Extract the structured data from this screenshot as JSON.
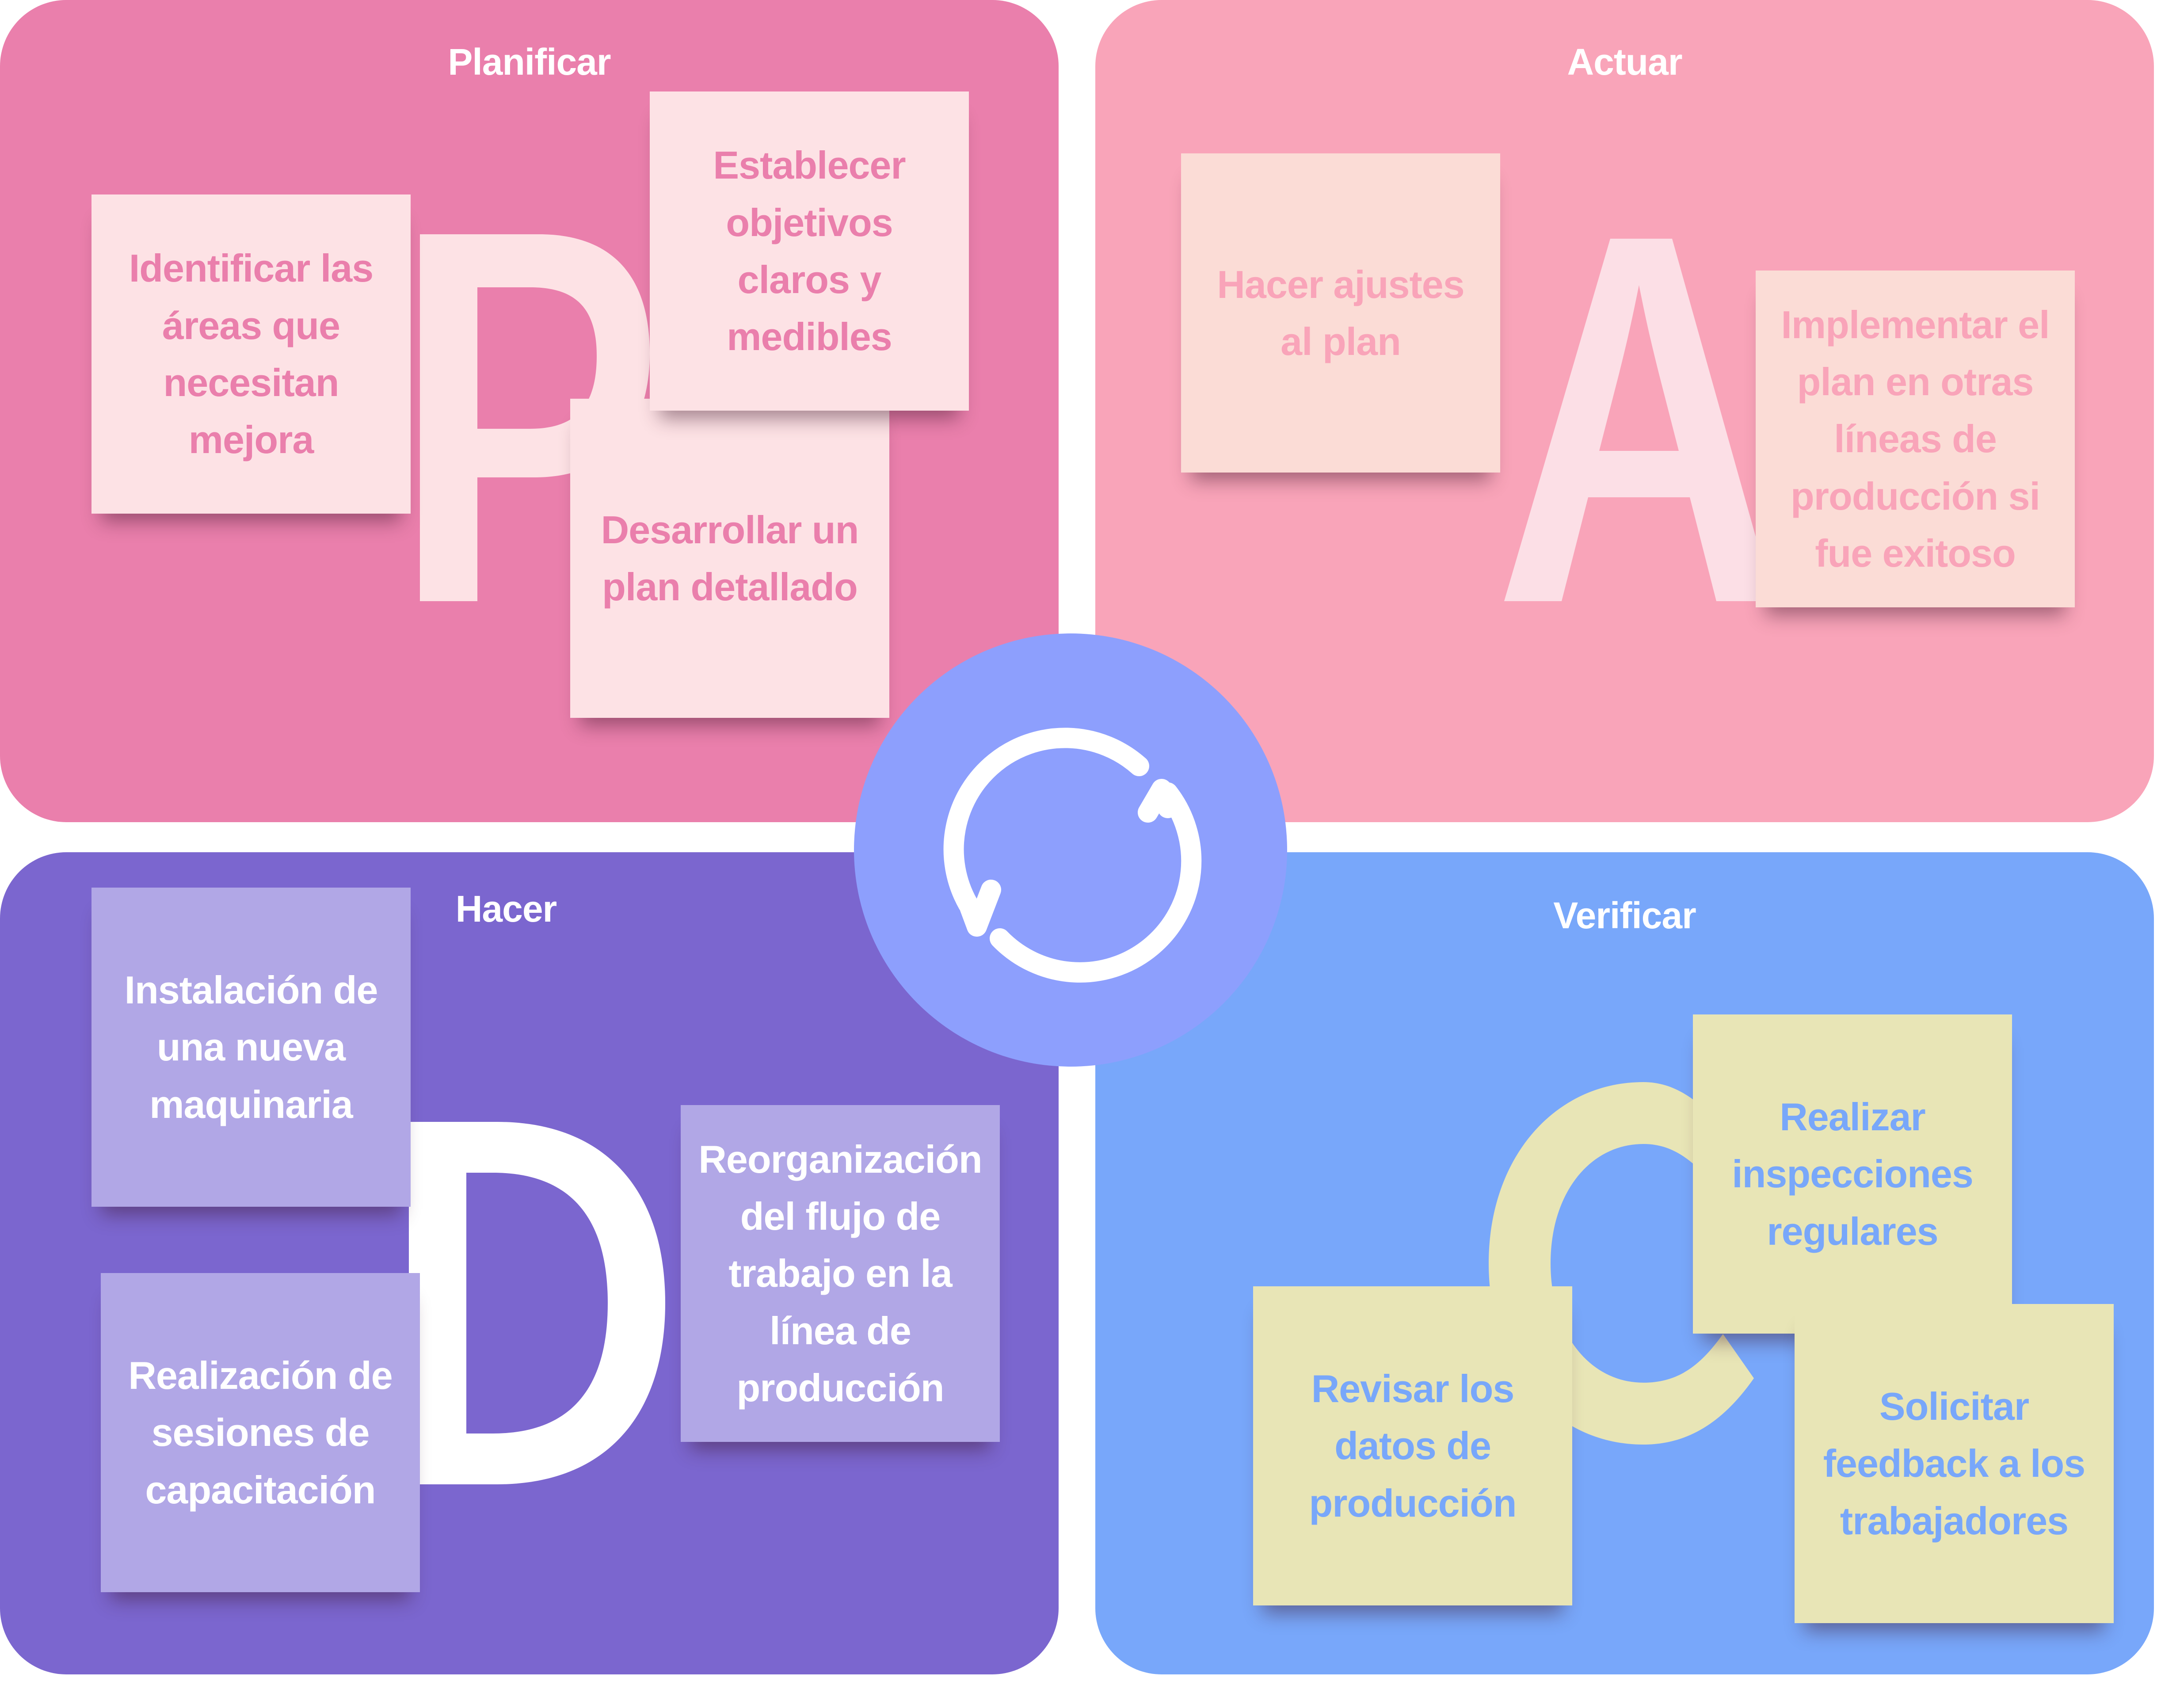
{
  "colors": {
    "plan_bg": "#ea7fac",
    "act_bg": "#f9a4b9",
    "do_bg": "#7b66cf",
    "check_bg": "#78a7fa",
    "cycle_bg": "#8d9ffd",
    "plan_note": "#fde2e5",
    "act_note": "#fbdcd6",
    "do_note": "#b1a7e6",
    "check_note": "#e8e5b6"
  },
  "center": {
    "icon": "cycle-refresh-icon"
  },
  "quadrants": {
    "plan": {
      "title": "Planificar",
      "letter": "P",
      "notes": [
        "Identificar las áreas que necesitan mejora",
        "Establecer objetivos claros y medibles",
        "Desarrollar un plan detallado"
      ]
    },
    "act": {
      "title": "Actuar",
      "letter": "A",
      "notes": [
        "Hacer ajustes al plan",
        "Implementar el plan en otras líneas de producción si fue exitoso"
      ]
    },
    "do": {
      "title": "Hacer",
      "letter": "D",
      "notes": [
        "Instalación de una nueva maquinaria",
        "Realización de sesiones de capacitación",
        "Reorganización del flujo de trabajo en la línea de producción"
      ]
    },
    "check": {
      "title": "Verificar",
      "letter": "C",
      "notes": [
        "Realizar inspecciones regulares",
        "Revisar los datos de producción",
        "Solicitar feedback a los trabajadores"
      ]
    }
  }
}
